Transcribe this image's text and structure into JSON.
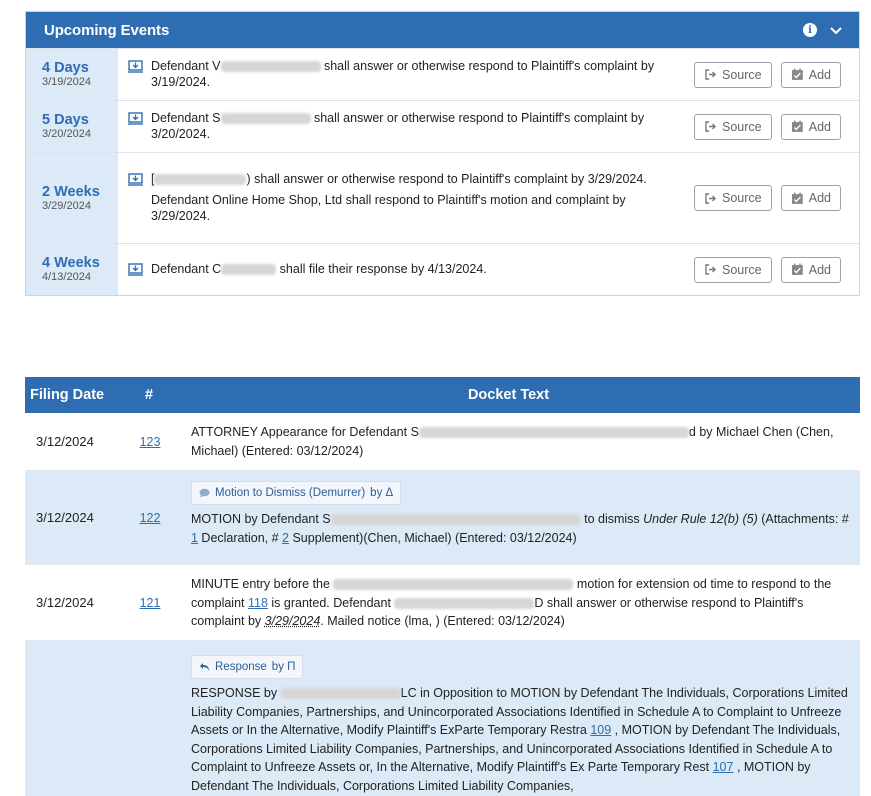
{
  "events": {
    "title": "Upcoming Events",
    "source_label": "Source",
    "add_label": "Add",
    "items": [
      {
        "relative": "4 Days",
        "date": "3/19/2024",
        "lines": [
          {
            "pre": "Defendant V",
            "post": "shall answer or otherwise respond to Plaintiff's complaint by 3/19/2024."
          }
        ]
      },
      {
        "relative": "5 Days",
        "date": "3/20/2024",
        "lines": [
          {
            "pre": "Defendant S",
            "post": "shall answer or otherwise respond to Plaintiff's complaint by 3/20/2024."
          }
        ]
      },
      {
        "relative": "2 Weeks",
        "date": "3/29/2024",
        "lines": [
          {
            "pre": "[",
            "post": ") shall answer or otherwise respond to Plaintiff's complaint by 3/29/2024."
          },
          {
            "pre": "",
            "post": "Defendant Online Home Shop, Ltd shall respond to Plaintiff's motion and complaint by 3/29/2024."
          }
        ]
      },
      {
        "relative": "4 Weeks",
        "date": "4/13/2024",
        "lines": [
          {
            "pre": "Defendant C",
            "post": "shall file their response by 4/13/2024."
          }
        ]
      }
    ]
  },
  "docket": {
    "headers": {
      "date": "Filing Date",
      "num": "#",
      "text": "Docket Text"
    },
    "rows": [
      {
        "date": "3/12/2024",
        "num": "123",
        "text_a": "ATTORNEY Appearance for Defendant S",
        "text_b": "d by Michael Chen (Chen, Michael) (Entered: 03/12/2024)"
      },
      {
        "date": "3/12/2024",
        "num": "122",
        "tag_label": "Motion to Dismiss (Demurrer)",
        "tag_by": "by Δ",
        "text_a": "MOTION by Defendant S",
        "text_b": " to dismiss ",
        "text_italic": "Under Rule 12(b) (5)",
        "text_c": " (Attachments: # ",
        "link1": "1",
        "text_d": " Declaration, # ",
        "link2": "2",
        "text_e": " Supplement)(Chen, Michael) (Entered: 03/12/2024)"
      },
      {
        "date": "3/12/2024",
        "num": "121",
        "text_a": "MINUTE entry before the ",
        "text_b": "motion for extension od time to respond to the complaint ",
        "link1": "118",
        "text_c": " is granted. Defendant ",
        "text_d": "D shall answer or otherwise respond to Plaintiff's complaint by ",
        "dotted_date": "3/29/2024",
        "text_e": ". Mailed notice (lma, ) (Entered: 03/12/2024)"
      },
      {
        "date": "",
        "num": "",
        "tag_label": "Response",
        "tag_by": "by Π",
        "text_a": "RESPONSE by ",
        "text_b": "LC in Opposition to MOTION by Defendant The Individuals, Corporations Limited Liability Companies, Partnerships, and Unincorporated Associations Identified in Schedule A to Complaint to Unfreeze Assets or In the Alternative, Modify Plaintiff's ExParte Temporary Restra ",
        "link1": "109",
        "text_c": " , MOTION by Defendant The Individuals, Corporations Limited Liability Companies, Partnerships, and Unincorporated Associations Identified in Schedule A to Complaint to Unfreeze Assets or, In the Alternative, Modify Plaintiff's Ex Parte Temporary Rest ",
        "link2": "107",
        "text_d": " , MOTION by Defendant The Individuals, Corporations Limited Liability Companies,"
      }
    ]
  }
}
